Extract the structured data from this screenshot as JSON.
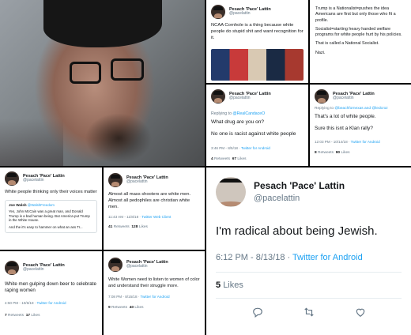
{
  "profile": {
    "name": "Pesach 'Pace' Lattin",
    "handle": "@pacelattin"
  },
  "t1": {
    "text": "NCAA Cornhole is a thing because white people do stupid shit and want recognition for it."
  },
  "t2": {
    "text1": "Trump is a Nationalist=pushes the idea Americans are first but only those who fit a profile.",
    "text2": "Socialist=starting heavy handed welfare programs for white people hurt by his policies.",
    "text3": "That is called a National Socialist.",
    "text4": "Nazi."
  },
  "t3": {
    "reply_prefix": "Replying to ",
    "reply_to": "@RealCandaceO",
    "text1": "What drug are you on?",
    "text2": "No one is racist against white people",
    "time": "3:46 PM - 8/5/18 · ",
    "via": "Twitter for Android",
    "retweets": "4",
    "retweets_label": "Retweets",
    "likes": "67",
    "likes_label": "Likes"
  },
  "t4": {
    "reply_prefix": "Replying to ",
    "reply_to": "@beachfornexas and @ledcroz",
    "text1": "That's a lot of white people.",
    "text2": "Sure this isnt a Klan rally?",
    "time": "12:03 PM - 10/14/18 · ",
    "via": "Twitter for Android",
    "retweets": "8",
    "retweets_label": "Retweets",
    "likes": "90",
    "likes_label": "Likes"
  },
  "t5": {
    "text": "White people thinking only their voices matter",
    "embed_name": "Joe Walsh",
    "embed_handle": "@WalshFreedom",
    "embed_text": "Yes, John McCain was a great man, and Donald Trump is a bad human being. But America put Trump in the White House.",
    "embed_text2": "And the it's easy to hammer on what an ass Tr..."
  },
  "t6": {
    "text": "Almost all mass shooters are white men. Almost all pedophiles are christian white men.",
    "time": "11:43 AM - 11/8/18 · ",
    "via": "Twitter Web Client",
    "retweets": "41",
    "retweets_label": "Retweets",
    "likes": "128",
    "likes_label": "Likes"
  },
  "t7": {
    "text": "White men gulping down beer to celebrate raping women",
    "time": "4:50 PM - 10/6/18 · ",
    "via": "Twitter for Android",
    "retweets": "7",
    "retweets_label": "Retweets",
    "likes": "17",
    "likes_label": "Likes"
  },
  "t8": {
    "text": "White Women need to listen to women of color and understand their struggle more.",
    "time": "7:08 PM - 8/15/18 · ",
    "via": "Twitter for Android",
    "retweets": "9",
    "retweets_label": "Retweets",
    "likes": "40",
    "likes_label": "Likes"
  },
  "t9": {
    "text": "I'm radical about being Jewish.",
    "time": "6:12 PM - 8/13/18 · ",
    "via": "Twitter for Android",
    "likes": "5",
    "likes_label": "Likes"
  },
  "icons": {
    "reply": "reply-icon",
    "retweet": "retweet-icon",
    "like": "heart-icon"
  },
  "colors": {
    "link": "#1da1f2",
    "meta": "#657786",
    "text": "#14171a"
  }
}
